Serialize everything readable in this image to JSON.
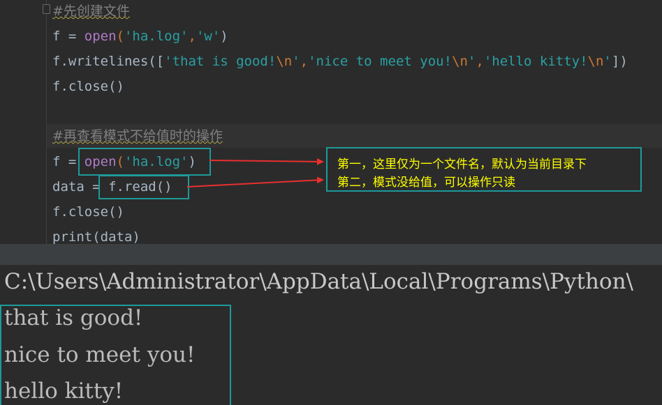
{
  "editor": {
    "line1": "#先创建文件",
    "line2": {
      "var": "f = ",
      "fn": "open",
      "p1": "(",
      "s1": "'ha.log'",
      "comma": ",",
      "s2": "'w'",
      "p2": ")"
    },
    "line3": {
      "pre": "f.writelines([",
      "s1": "'that is good!",
      "e1": "\\n",
      "q1": "'",
      "c1": ",",
      "s2": "'nice to meet you!",
      "e2": "\\n",
      "q2": "'",
      "c2": ",",
      "s3": "'hello kitty!",
      "e3": "\\n",
      "q3": "'",
      "post": "])"
    },
    "line4": "f.close()",
    "line5": "#再查看模式不给值时的操作",
    "line6": {
      "var": "f = ",
      "fn": "open",
      "p1": "(",
      "s1": "'ha.log'",
      "p2": ")"
    },
    "line7": {
      "pre": "data = ",
      "call": "f.read()"
    },
    "line8": "f.close()",
    "line9": "print(data)"
  },
  "annotation": {
    "line1": "第一，这里仅为一个文件名，默认为当前目录下",
    "line2": "第二，模式没给值，可以操作只读"
  },
  "console": {
    "path": "C:\\Users\\Administrator\\AppData\\Local\\Programs\\Python\\",
    "output": [
      "that is good!",
      "nice to meet you!",
      "hello kitty!"
    ]
  },
  "colors": {
    "accent_box": "#1e9a9a",
    "arrow": "#e8302f",
    "annotation_text": "#ffff00"
  }
}
